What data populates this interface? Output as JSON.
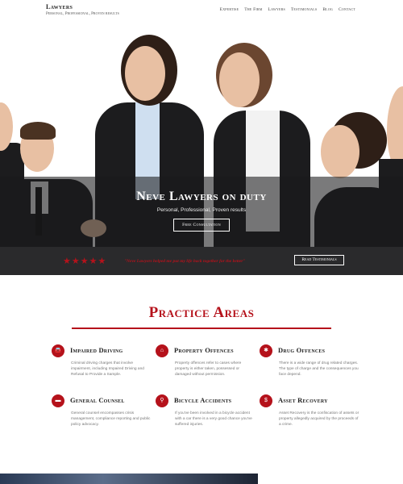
{
  "brand": {
    "name": "Lawyers",
    "tagline": "Personal, Professional, Proven results"
  },
  "nav": [
    "Expertise",
    "The Firm",
    "Lawyers",
    "Testimonials",
    "Blog",
    "Contact"
  ],
  "hero": {
    "title": "Neve Lawyers on duty",
    "subtitle": "Personal, Professional, Proven results",
    "button": "Free Consultation"
  },
  "testimonial": {
    "stars": "★★★★★",
    "quote": "\"Neve Lawyers helped me put my life back together for the better\"",
    "button": "Read Testimonials"
  },
  "practice": {
    "title": "Practice Areas",
    "items": [
      {
        "icon": "car-icon",
        "glyph": "🚘",
        "title": "Impaired Driving",
        "desc": "Criminal driving charges that involve impairment, including Impaired Driving and Refusal to Provide a Sample."
      },
      {
        "icon": "home-icon",
        "glyph": "⌂",
        "title": "Property Offences",
        "desc": "Property offences refer to cases where property is either taken, possessed or damaged without permission."
      },
      {
        "icon": "cannabis-icon",
        "glyph": "✱",
        "title": "Drug Offences",
        "desc": "There is a wide range of drug related charges. The type of charge and the consequences you face depend."
      },
      {
        "icon": "briefcase-icon",
        "glyph": "▬",
        "title": "General Counsel",
        "desc": "General counsel encompasses crisis management, compliance reporting and public policy advocacy."
      },
      {
        "icon": "bicycle-icon",
        "glyph": "⚲",
        "title": "Bicycle Accidents",
        "desc": "If you've been involved in a bicycle accident with a car there is a very good chance you've suffered injuries."
      },
      {
        "icon": "dollar-icon",
        "glyph": "$",
        "title": "Asset Recovery",
        "desc": "Asset Recovery is the confiscation of assets or property allegedly acquired by the proceeds of a crime."
      }
    ]
  },
  "colors": {
    "accent": "#b5121b",
    "dark": "#2a2a2c"
  }
}
